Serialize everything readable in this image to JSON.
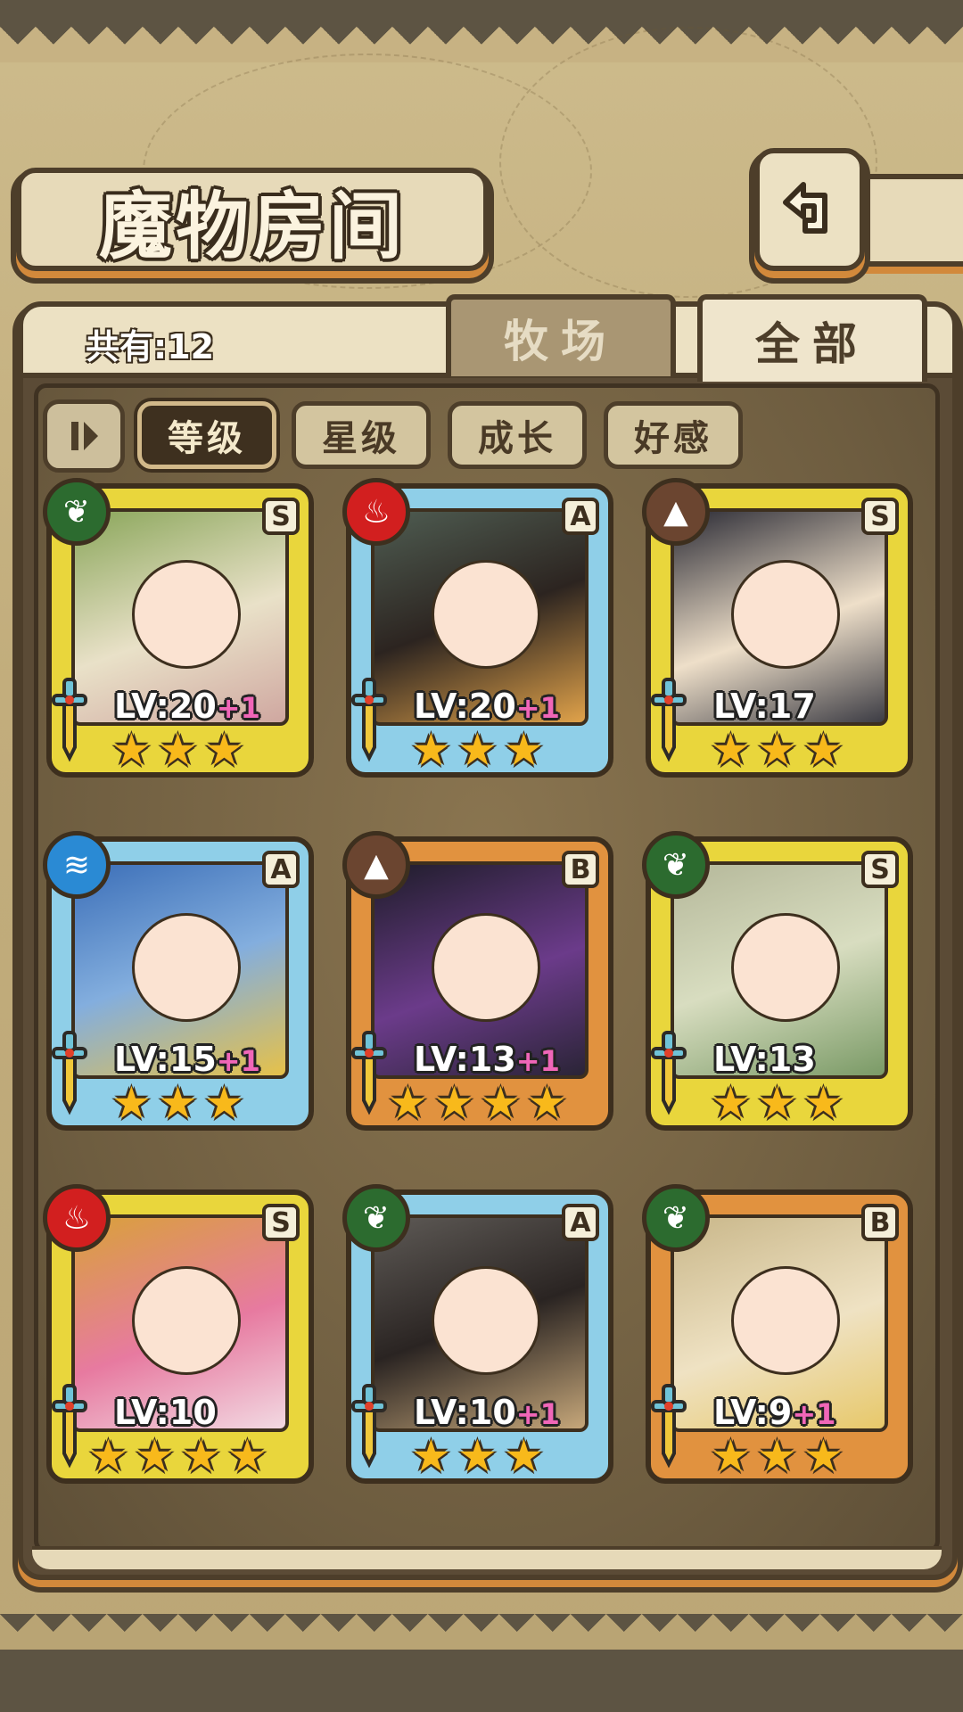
{
  "header": {
    "title": "魔物房间",
    "back_icon": "return-arrow-icon"
  },
  "summary": {
    "count_label": "共有:12"
  },
  "tabs": [
    {
      "label": "牧场",
      "active": false
    },
    {
      "label": "全部",
      "active": true
    }
  ],
  "sort_filters": [
    {
      "label": "等级",
      "active": true
    },
    {
      "label": "星级",
      "active": false
    },
    {
      "label": "成长",
      "active": false
    },
    {
      "label": "好感",
      "active": false
    }
  ],
  "monsters": [
    {
      "rank": "S",
      "element": "leaf",
      "level": "LV:20",
      "bonus": "+1",
      "stars": 3,
      "frame": "gold"
    },
    {
      "rank": "A",
      "element": "fire",
      "level": "LV:20",
      "bonus": "+1",
      "stars": 3,
      "frame": "blue"
    },
    {
      "rank": "S",
      "element": "earth",
      "level": "LV:17",
      "bonus": "",
      "stars": 3,
      "frame": "gold"
    },
    {
      "rank": "A",
      "element": "water",
      "level": "LV:15",
      "bonus": "+1",
      "stars": 3,
      "frame": "blue"
    },
    {
      "rank": "B",
      "element": "earth",
      "level": "LV:13",
      "bonus": "+1",
      "stars": 4,
      "frame": "orange"
    },
    {
      "rank": "S",
      "element": "leaf",
      "level": "LV:13",
      "bonus": "",
      "stars": 3,
      "frame": "gold"
    },
    {
      "rank": "S",
      "element": "fire",
      "level": "LV:10",
      "bonus": "",
      "stars": 4,
      "frame": "gold"
    },
    {
      "rank": "A",
      "element": "leaf",
      "level": "LV:10",
      "bonus": "+1",
      "stars": 3,
      "frame": "blue"
    },
    {
      "rank": "B",
      "element": "leaf",
      "level": "LV:9",
      "bonus": "+1",
      "stars": 3,
      "frame": "orange"
    }
  ],
  "colors": {
    "gold_frame": "#e9d63c",
    "blue_frame": "#8fcfe8",
    "orange_frame": "#e1923f",
    "bonus_pink": "#f066b8",
    "star": "#f8b91b"
  }
}
